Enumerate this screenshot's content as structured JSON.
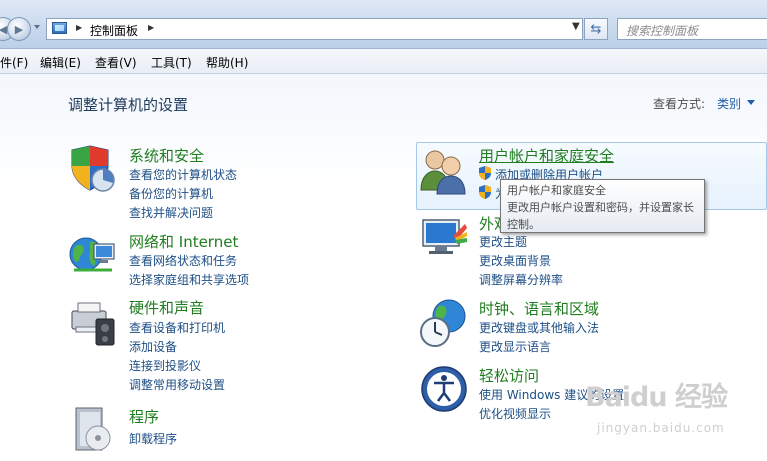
{
  "address_bar": {
    "path": [
      "控制面板"
    ],
    "search_placeholder": "搜索控制面板"
  },
  "menu": [
    {
      "label": "件(F)"
    },
    {
      "label": "编辑(E)"
    },
    {
      "label": "查看(V)"
    },
    {
      "label": "工具(T)"
    },
    {
      "label": "帮助(H)"
    }
  ],
  "page": {
    "title": "调整计算机的设置",
    "view_by_label": "查看方式:",
    "view_by_value": "类别"
  },
  "categories_left": [
    {
      "icon": "system-security-icon",
      "title": "系统和安全",
      "links": [
        "查看您的计算机状态",
        "备份您的计算机",
        "查找并解决问题"
      ]
    },
    {
      "icon": "network-internet-icon",
      "title": "网络和 Internet",
      "links": [
        "查看网络状态和任务",
        "选择家庭组和共享选项"
      ]
    },
    {
      "icon": "hardware-sound-icon",
      "title": "硬件和声音",
      "links": [
        "查看设备和打印机",
        "添加设备",
        "连接到投影仪",
        "调整常用移动设置"
      ]
    },
    {
      "icon": "programs-icon",
      "title": "程序",
      "links": [
        "卸载程序"
      ]
    }
  ],
  "categories_right": [
    {
      "icon": "user-accounts-icon",
      "title": "用户帐户和家庭安全",
      "links": [
        "添加或删除用户帐户",
        "为"
      ],
      "hovered": true
    },
    {
      "icon": "appearance-icon",
      "title": "外观",
      "links": [
        "更改主题",
        "更改桌面背景",
        "调整屏幕分辨率"
      ]
    },
    {
      "icon": "clock-language-region-icon",
      "title": "时钟、语言和区域",
      "links": [
        "更改键盘或其他输入法",
        "更改显示语言"
      ]
    },
    {
      "icon": "ease-of-access-icon",
      "title": "轻松访问",
      "links": [
        "使用 Windows 建议的设置",
        "优化视频显示"
      ]
    }
  ],
  "tooltip": {
    "title": "用户帐户和家庭安全",
    "body": "更改用户帐户设置和密码，并设置家长控制。"
  },
  "watermark": {
    "logo": "Baidu 经验",
    "url": "jingyan.baidu.com"
  }
}
